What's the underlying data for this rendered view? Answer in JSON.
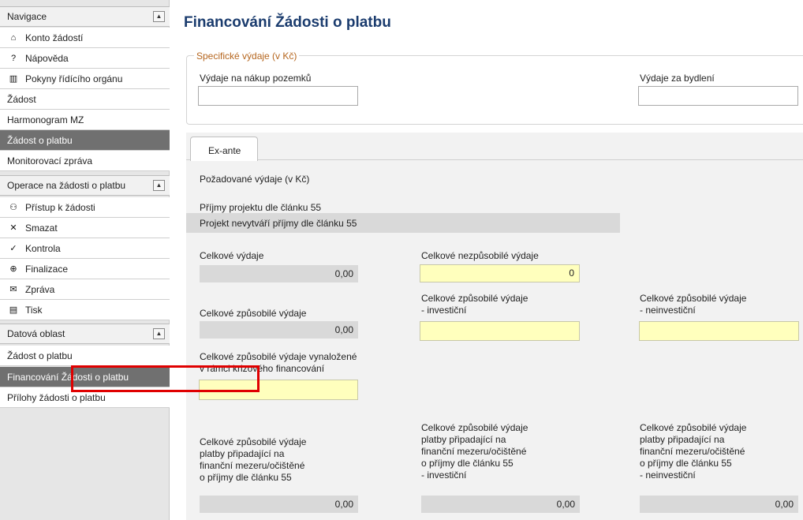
{
  "sidebar": {
    "navigation": {
      "title": "Navigace",
      "items": [
        {
          "icon": "home-icon",
          "glyph": "⌂",
          "label": "Konto žádostí"
        },
        {
          "icon": "help-icon",
          "glyph": "?",
          "label": "Nápověda"
        },
        {
          "icon": "book-icon",
          "glyph": "▥",
          "label": "Pokyny řídícího orgánu"
        },
        {
          "label": "Žádost"
        },
        {
          "label": "Harmonogram MZ"
        },
        {
          "label": "Žádost o platbu",
          "selected": true
        },
        {
          "label": "Monitorovací zpráva"
        }
      ]
    },
    "operations": {
      "title": "Operace na žádosti o platbu",
      "items": [
        {
          "icon": "access-icon",
          "glyph": "⚇",
          "label": "Přístup k žádosti"
        },
        {
          "icon": "delete-icon",
          "glyph": "✕",
          "label": "Smazat"
        },
        {
          "icon": "check-icon",
          "glyph": "✓",
          "label": "Kontrola"
        },
        {
          "icon": "lock-icon",
          "glyph": "⊕",
          "label": "Finalizace"
        },
        {
          "icon": "message-icon",
          "glyph": "✉",
          "label": "Zpráva"
        },
        {
          "icon": "print-icon",
          "glyph": "▤",
          "label": "Tisk"
        }
      ]
    },
    "data_area": {
      "title": "Datová oblast",
      "items": [
        {
          "label": "Žádost o platbu"
        },
        {
          "label": "Financování Žádosti o platbu",
          "selected": true
        },
        {
          "label": "Přílohy žádosti o platbu"
        }
      ]
    }
  },
  "main": {
    "title": "Financování Žádosti o platbu",
    "specific": {
      "legend": "Specifické výdaje (v Kč)",
      "land_label": "Výdaje na nákup pozemků",
      "housing_label": "Výdaje za bydlení"
    },
    "tabs": [
      {
        "label": "Ex-ante"
      }
    ],
    "requested_label": "Požadované výdaje (v Kč)",
    "income_label": "Příjmy projektu dle článku 55",
    "income_value": "Projekt nevytváří příjmy dle článku 55",
    "total_label": "Celkové výdaje",
    "total_value": "0,00",
    "ineligible_label": "Celkové nezpůsobilé výdaje",
    "ineligible_value": "0",
    "eligible_label": "Celkové způsobilé výdaje",
    "eligible_value": "0,00",
    "eligible_inv_label": [
      "Celkové způsobilé výdaje",
      "- investiční"
    ],
    "eligible_noninv_label": [
      "Celkové způsobilé výdaje",
      "- neinvestiční"
    ],
    "crisis_label": [
      "Celkové způsobilé výdaje vynaložené",
      "v rámci krizového financování"
    ],
    "gap_label": [
      "Celkové způsobilé výdaje",
      "platby připadající na",
      "finanční mezeru/očištěné",
      "o příjmy dle článku 55"
    ],
    "gap_value": "0,00",
    "gap_inv_label": [
      "Celkové způsobilé výdaje",
      "platby připadající na",
      "finanční mezeru/očištěné",
      "o příjmy dle článku 55",
      "- investiční"
    ],
    "gap_inv_value": "0,00",
    "gap_noninv_label": [
      "Celkové způsobilé výdaje",
      "platby připadající na",
      "finanční mezeru/očištěné",
      "o příjmy dle článku 55",
      "- neinvestiční"
    ],
    "gap_noninv_value": "0,00"
  },
  "colors": {
    "title": "#1b3c6e",
    "legend": "#b5651d",
    "selected": "#707070",
    "highlight": "#e00000",
    "editable": "#ffffbd"
  }
}
